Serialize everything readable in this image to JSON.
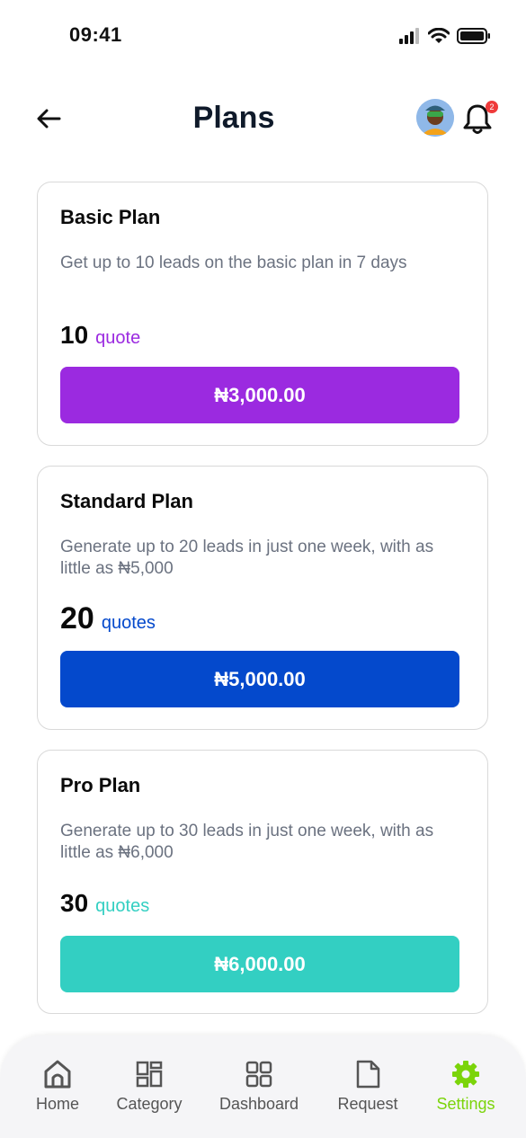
{
  "status_bar": {
    "time": "09:41"
  },
  "header": {
    "title": "Plans",
    "notification_count": "2"
  },
  "plans": [
    {
      "title": "Basic Plan",
      "description": "Get up to 10 leads on the basic plan in 7 days",
      "quota": "10",
      "quota_unit": "quote",
      "price": "₦3,000.00",
      "accent": "#9b2ae0"
    },
    {
      "title": "Standard Plan",
      "description": "Generate up to 20 leads in just one week, with as little as ₦5,000",
      "quota": "20",
      "quota_unit": "quotes",
      "price": "₦5,000.00",
      "accent": "#0449cc"
    },
    {
      "title": "Pro Plan",
      "description": "Generate up to 30 leads in just one week, with as little as ₦6,000",
      "quota": "30",
      "quota_unit": "quotes",
      "price": "₦6,000.00",
      "accent": "#33cfc2"
    }
  ],
  "tabs": [
    {
      "label": "Home",
      "icon": "home-icon"
    },
    {
      "label": "Category",
      "icon": "category-icon"
    },
    {
      "label": "Dashboard",
      "icon": "dashboard-icon"
    },
    {
      "label": "Request",
      "icon": "document-icon"
    },
    {
      "label": "Settings",
      "icon": "gear-icon",
      "active": true
    }
  ],
  "colors": {
    "active_tab": "#7bd40a",
    "inactive_tab": "#555555"
  }
}
